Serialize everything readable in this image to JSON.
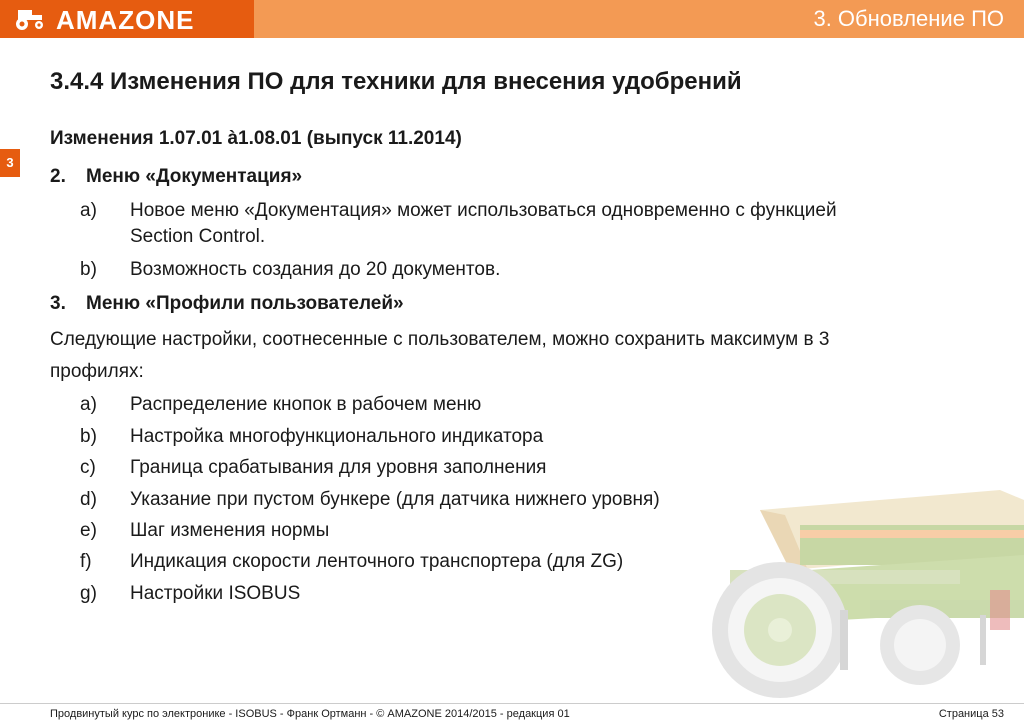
{
  "header": {
    "brand": "AMAZONE",
    "section_title": "3.  Обновление ПО",
    "colors": {
      "brand_orange": "#e65c10",
      "header_orange": "#f39a54"
    }
  },
  "title": "3.4.4 Изменения ПО для техники для внесения удобрений",
  "chapter_tab": "3",
  "changes_heading": "Изменения 1.07.01 à1.08.01 (выпуск 11.2014)",
  "section2": {
    "number": "2.",
    "label": "Меню «Документация»",
    "items": [
      {
        "marker": "a)",
        "text": "Новое меню «Документация» может использоваться одновременно с функцией",
        "text2": "Section Control."
      },
      {
        "marker": "b)",
        "text": "Возможность создания до 20 документов."
      }
    ]
  },
  "section3": {
    "number": "3.",
    "label": "Меню «Профили пользователей»",
    "intro_line1": "Следующие настройки, соотнесенные с пользователем, можно сохранить максимум в 3",
    "intro_line2": "профилях:",
    "items": [
      {
        "marker": "a)",
        "text": "Распределение кнопок в рабочем меню"
      },
      {
        "marker": "b)",
        "text": "Настройка многофункционального индикатора"
      },
      {
        "marker": "c)",
        "text": "Граница срабатывания для уровня заполнения"
      },
      {
        "marker": "d)",
        "text": "Указание при пустом бункере (для датчика нижнего уровня)"
      },
      {
        "marker": "e)",
        "text": "Шаг изменения нормы"
      },
      {
        "marker": "f)",
        "text": "Индикация скорости ленточного транспортера (для ZG)"
      },
      {
        "marker": "g)",
        "text": "Настройки ISOBUS"
      }
    ]
  },
  "footer": {
    "left": "Продвинутый курс по электронике - ISOBUS - Франк Ортманн - © AMAZONE 2014/2015 - редакция 01",
    "right": "Страница 53"
  }
}
